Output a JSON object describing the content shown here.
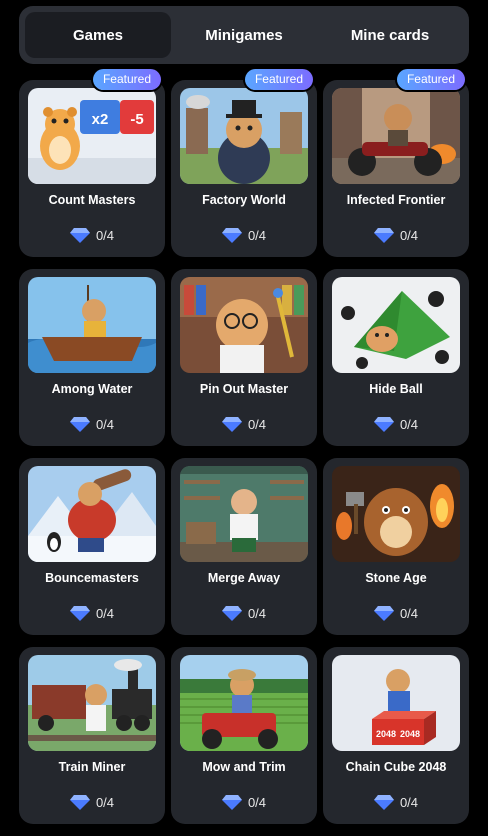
{
  "tabs": [
    {
      "label": "Games",
      "active": true
    },
    {
      "label": "Minigames",
      "active": false
    },
    {
      "label": "Mine cards",
      "active": false
    }
  ],
  "badge_label": "Featured",
  "cards": [
    {
      "title": "Count Masters",
      "progress": "0/4",
      "featured": true,
      "image_labels": [
        "x2",
        "-5"
      ]
    },
    {
      "title": "Factory World",
      "progress": "0/4",
      "featured": true
    },
    {
      "title": "Infected Frontier",
      "progress": "0/4",
      "featured": true
    },
    {
      "title": "Among Water",
      "progress": "0/4",
      "featured": false
    },
    {
      "title": "Pin Out Master",
      "progress": "0/4",
      "featured": false
    },
    {
      "title": "Hide Ball",
      "progress": "0/4",
      "featured": false
    },
    {
      "title": "Bouncemasters",
      "progress": "0/4",
      "featured": false
    },
    {
      "title": "Merge Away",
      "progress": "0/4",
      "featured": false
    },
    {
      "title": "Stone Age",
      "progress": "0/4",
      "featured": false
    },
    {
      "title": "Train Miner",
      "progress": "0/4",
      "featured": false
    },
    {
      "title": "Mow and Trim",
      "progress": "0/4",
      "featured": false
    },
    {
      "title": "Chain Cube 2048",
      "progress": "0/4",
      "featured": false,
      "image_labels": [
        "2048",
        "2048"
      ]
    }
  ],
  "colors": {
    "badge_start": "#5aa6ff",
    "badge_end": "#7c6cff",
    "card": "#24272d",
    "diamond": "#4b7bff"
  }
}
